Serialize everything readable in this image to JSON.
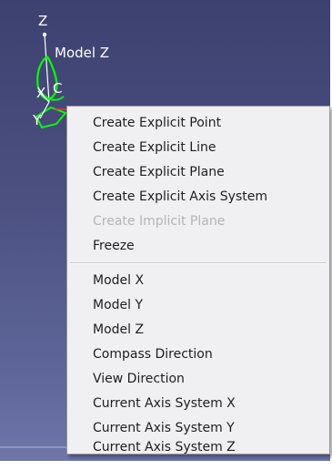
{
  "viewport": {
    "compass": {
      "axis_z_label": "Z",
      "model_z_label": "Model Z",
      "axis_x_label": "X",
      "axis_y_label": "Y",
      "origin_label": "C"
    }
  },
  "context_menu": {
    "items": [
      {
        "label": "Create Explicit Point",
        "enabled": true
      },
      {
        "label": "Create Explicit Line",
        "enabled": true
      },
      {
        "label": "Create Explicit Plane",
        "enabled": true
      },
      {
        "label": "Create Explicit Axis System",
        "enabled": true
      },
      {
        "label": "Create Implicit Plane",
        "enabled": false
      },
      {
        "label": "Freeze",
        "enabled": true
      },
      {
        "label": "Model X",
        "enabled": true
      },
      {
        "label": "Model Y",
        "enabled": true
      },
      {
        "label": "Model Z",
        "enabled": true
      },
      {
        "label": "Compass Direction",
        "enabled": true
      },
      {
        "label": "View Direction",
        "enabled": true
      },
      {
        "label": "Current Axis System X",
        "enabled": true
      },
      {
        "label": "Current Axis System Y",
        "enabled": true
      },
      {
        "label": "Current Axis System Z",
        "enabled": true
      }
    ]
  },
  "colors": {
    "viewport_background": "#4c5182",
    "compass_highlight": "#00ff00",
    "menu_background": "#f0f0f3",
    "disabled_text": "#b4b4b4"
  }
}
